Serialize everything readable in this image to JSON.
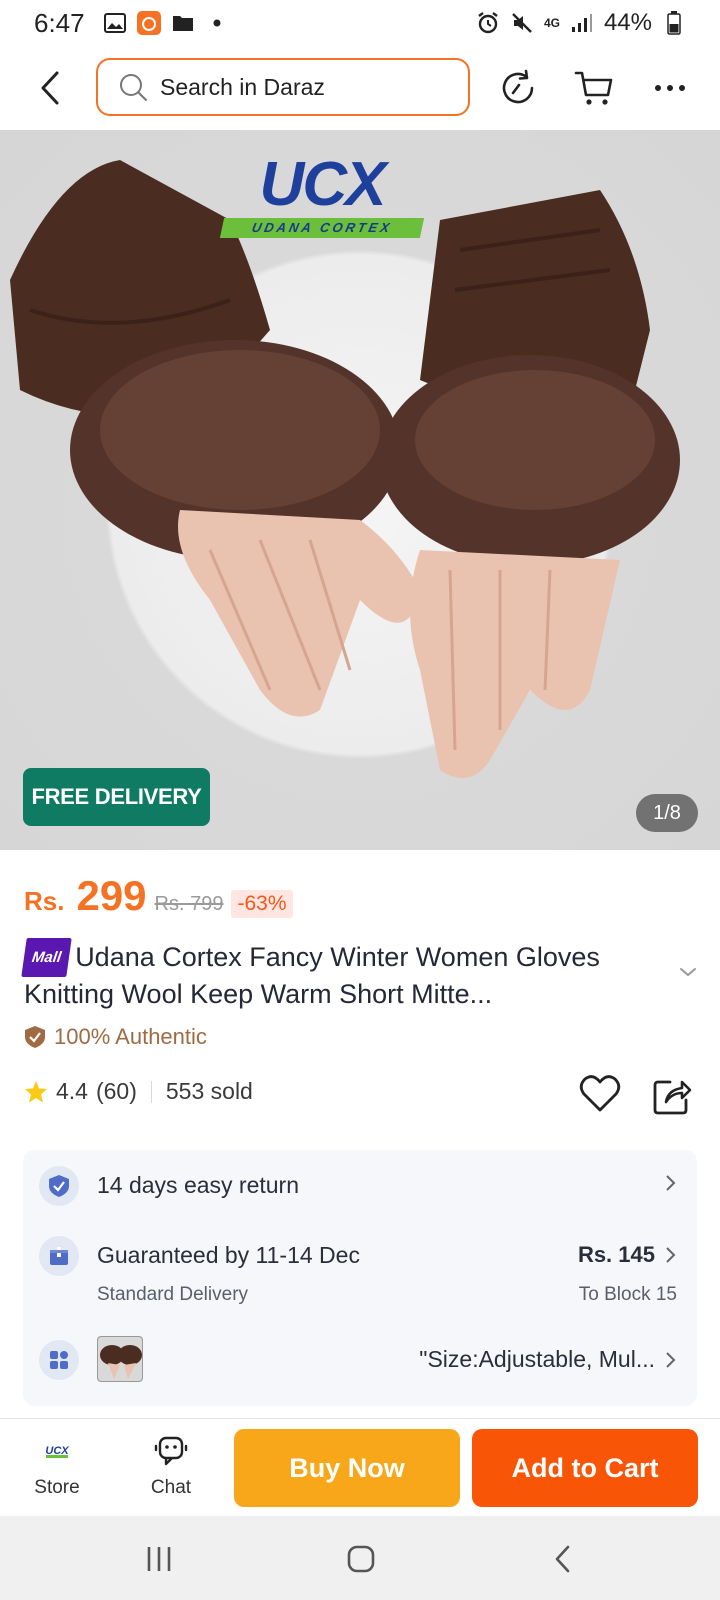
{
  "status_bar": {
    "time": "6:47",
    "network": "4G",
    "battery": "44%",
    "icons": [
      "gallery-icon",
      "app-notification-icon",
      "folder-icon",
      "dot-icon",
      "alarm-icon",
      "mute-icon",
      "signal-icon",
      "battery-icon"
    ]
  },
  "header": {
    "search_placeholder": "Search in Daraz",
    "icons": [
      "back-arrow-icon",
      "search-icon",
      "history-icon",
      "cart-icon",
      "more-icon"
    ]
  },
  "product_image": {
    "brand_logo_text": "UCX",
    "brand_logo_subtext": "UDANA CORTEX",
    "free_delivery_label": "FREE DELIVERY",
    "image_counter": "1/8"
  },
  "price": {
    "currency": "Rs.",
    "current": "299",
    "original": "Rs. 799",
    "discount": "-63%"
  },
  "product": {
    "mall_badge": "Mall",
    "title": "Udana Cortex Fancy Winter Women Gloves Knitting Wool Keep Warm Short Mitte...",
    "authentic_label": "100% Authentic",
    "rating": "4.4",
    "rating_count": "(60)",
    "sold": "553 sold"
  },
  "info": {
    "return_text": "14 days easy return",
    "delivery_title": "Guaranteed by 11-14 Dec",
    "delivery_sub": "Standard Delivery",
    "delivery_price": "Rs. 145",
    "delivery_location": "To Block 15",
    "variant_text": "\"Size:Adjustable, Mul..."
  },
  "bottom_bar": {
    "store_label": "Store",
    "chat_label": "Chat",
    "buy_now_label": "Buy Now",
    "add_to_cart_label": "Add to Cart"
  },
  "colors": {
    "accent_orange": "#f57224",
    "buy_now": "#f9a71a",
    "add_to_cart": "#f85606",
    "free_delivery": "#0f7b63",
    "mall_purple": "#5a18b0"
  }
}
